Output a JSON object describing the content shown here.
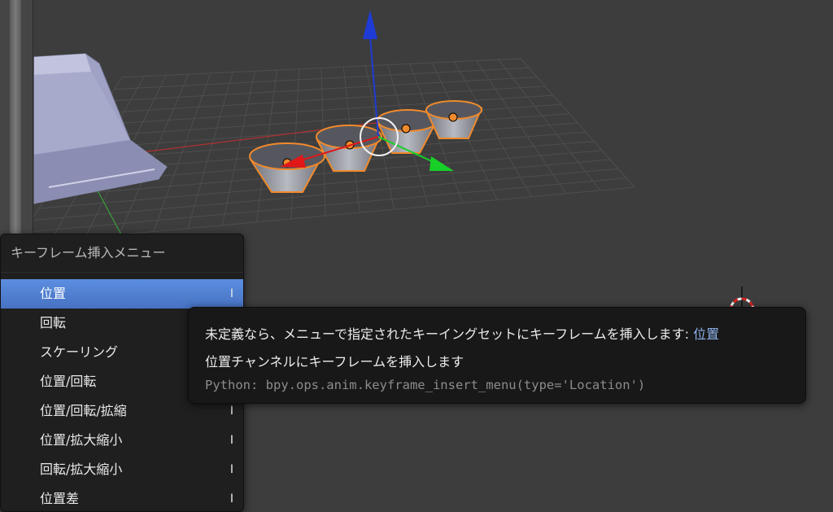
{
  "keyframe_menu": {
    "title": "キーフレーム挿入メニュー",
    "items": [
      {
        "label": "位置",
        "shortcut": "I",
        "active": true
      },
      {
        "label": "回転",
        "shortcut": "",
        "active": false
      },
      {
        "label": "スケーリング",
        "shortcut": "",
        "active": false
      },
      {
        "label": "位置/回転",
        "shortcut": "",
        "active": false
      },
      {
        "label": "位置/回転/拡縮",
        "shortcut": "I",
        "active": false
      },
      {
        "label": "位置/拡大縮小",
        "shortcut": "I",
        "active": false
      },
      {
        "label": "回転/拡大縮小",
        "shortcut": "I",
        "active": false
      },
      {
        "label": "位置差",
        "shortcut": "I",
        "active": false
      }
    ]
  },
  "tooltip": {
    "description": "未定義なら、メニューで指定されたキーイングセットにキーフレームを挿入します:",
    "highlight": "位置",
    "detail": "位置チャンネルにキーフレームを挿入します",
    "python": "Python: bpy.ops.anim.keyframe_insert_menu(type='Location')"
  },
  "colors": {
    "viewport_bg": "#3d3d3d",
    "grid_line": "#4e4e4e",
    "x_axis": "#b03030",
    "y_axis": "#3aa03a",
    "z_gizmo": "#1f3bd6",
    "x_gizmo": "#e01818",
    "y_gizmo": "#18d028",
    "selection_outline": "#f08a2c",
    "menu_highlight": "#5680d8",
    "tooltip_highlight": "#8fb4ee"
  },
  "icons": [
    "3d-cursor-icon",
    "transform-gizmo-icon"
  ]
}
